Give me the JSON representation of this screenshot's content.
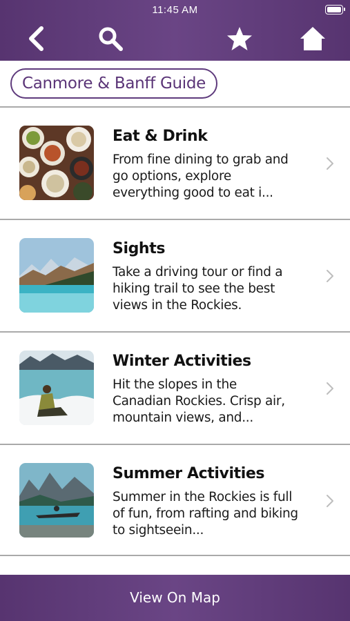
{
  "status_bar": {
    "time": "11:45 AM"
  },
  "nav": {
    "back_icon": "chevron-left-icon",
    "search_icon": "search-icon",
    "favorites_icon": "star-icon",
    "home_icon": "home-icon"
  },
  "guide_chip": {
    "label": "Canmore & Banff Guide"
  },
  "categories": [
    {
      "title": "Eat & Drink",
      "description": "From fine dining to grab and go options, explore everything good to eat i...",
      "image": "food-spread-photo"
    },
    {
      "title": "Sights",
      "description": "Take a driving tour or find a hiking trail to see the best views in the Rockies.",
      "image": "mountain-lake-photo"
    },
    {
      "title": "Winter Activities",
      "description": "Hit the slopes in the Canadian Rockies. Crisp air, mountain views, and...",
      "image": "winter-snow-photo"
    },
    {
      "title": "Summer Activities",
      "description": "Summer in the Rockies is full of fun, from rafting and biking to sightseein...",
      "image": "canoe-lake-photo"
    }
  ],
  "bottom_bar": {
    "label": "View On Map"
  },
  "colors": {
    "brand_purple": "#5e3a7c",
    "divider": "#a9a9a9"
  }
}
